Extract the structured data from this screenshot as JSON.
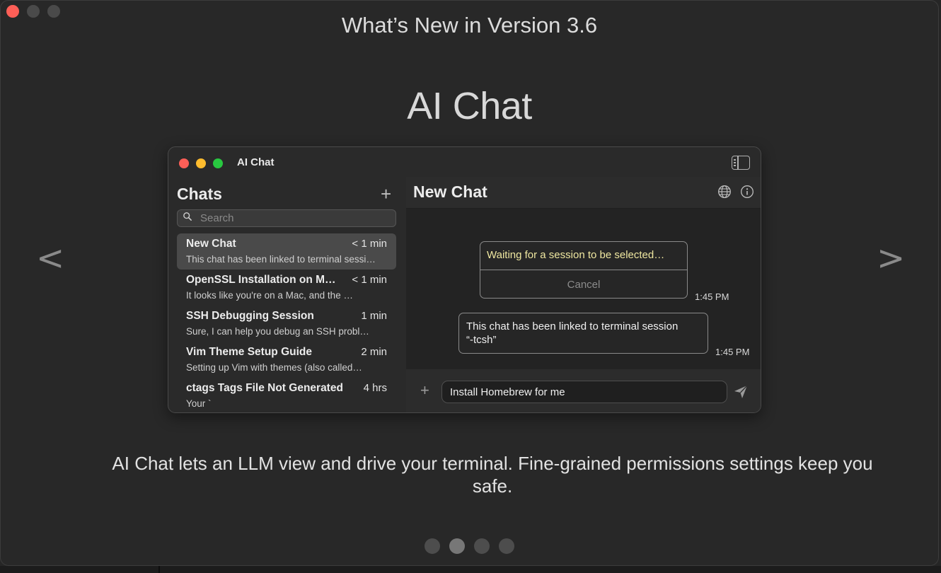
{
  "window": {
    "title": "What’s New in Version 3.6"
  },
  "feature": {
    "title": "AI Chat",
    "description": "AI Chat lets an LLM view and drive your terminal. Fine-grained permissions settings keep you safe.",
    "prev_label": "<",
    "next_label": ">",
    "page_count": 4,
    "active_page": 2
  },
  "app": {
    "title": "AI Chat",
    "sidebar": {
      "heading": "Chats",
      "add_label": "+",
      "search_placeholder": "Search",
      "items": [
        {
          "title": "New Chat",
          "time": "< 1 min",
          "preview": "This chat has been linked to terminal sessi…",
          "selected": true
        },
        {
          "title": "OpenSSL Installation on M…",
          "time": "< 1 min",
          "preview": "It looks like you're on a Mac, and the …",
          "selected": false
        },
        {
          "title": "SSH Debugging Session",
          "time": "1 min",
          "preview": "Sure, I can help you debug an SSH probl…",
          "selected": false
        },
        {
          "title": "Vim Theme Setup Guide",
          "time": "2 min",
          "preview": "Setting up Vim with themes (also called…",
          "selected": false
        },
        {
          "title": "ctags Tags File Not Generated",
          "time": "4 hrs",
          "preview": "Your `",
          "selected": false
        }
      ]
    },
    "main": {
      "title": "New Chat",
      "messages": {
        "waiting_text": "Waiting for a session to be selected…",
        "cancel_label": "Cancel",
        "waiting_time": "1:45 PM",
        "linked_line1": "This chat has been linked to terminal session",
        "linked_line2": "“-tcsh”",
        "linked_time": "1:45 PM"
      },
      "composer": {
        "add_label": "+",
        "input_value": "Install Homebrew for me"
      }
    }
  },
  "colors": {
    "close": "#fe5f57",
    "minimize": "#febc2e",
    "zoom": "#28c840",
    "waiting_text": "#efe7a0"
  }
}
